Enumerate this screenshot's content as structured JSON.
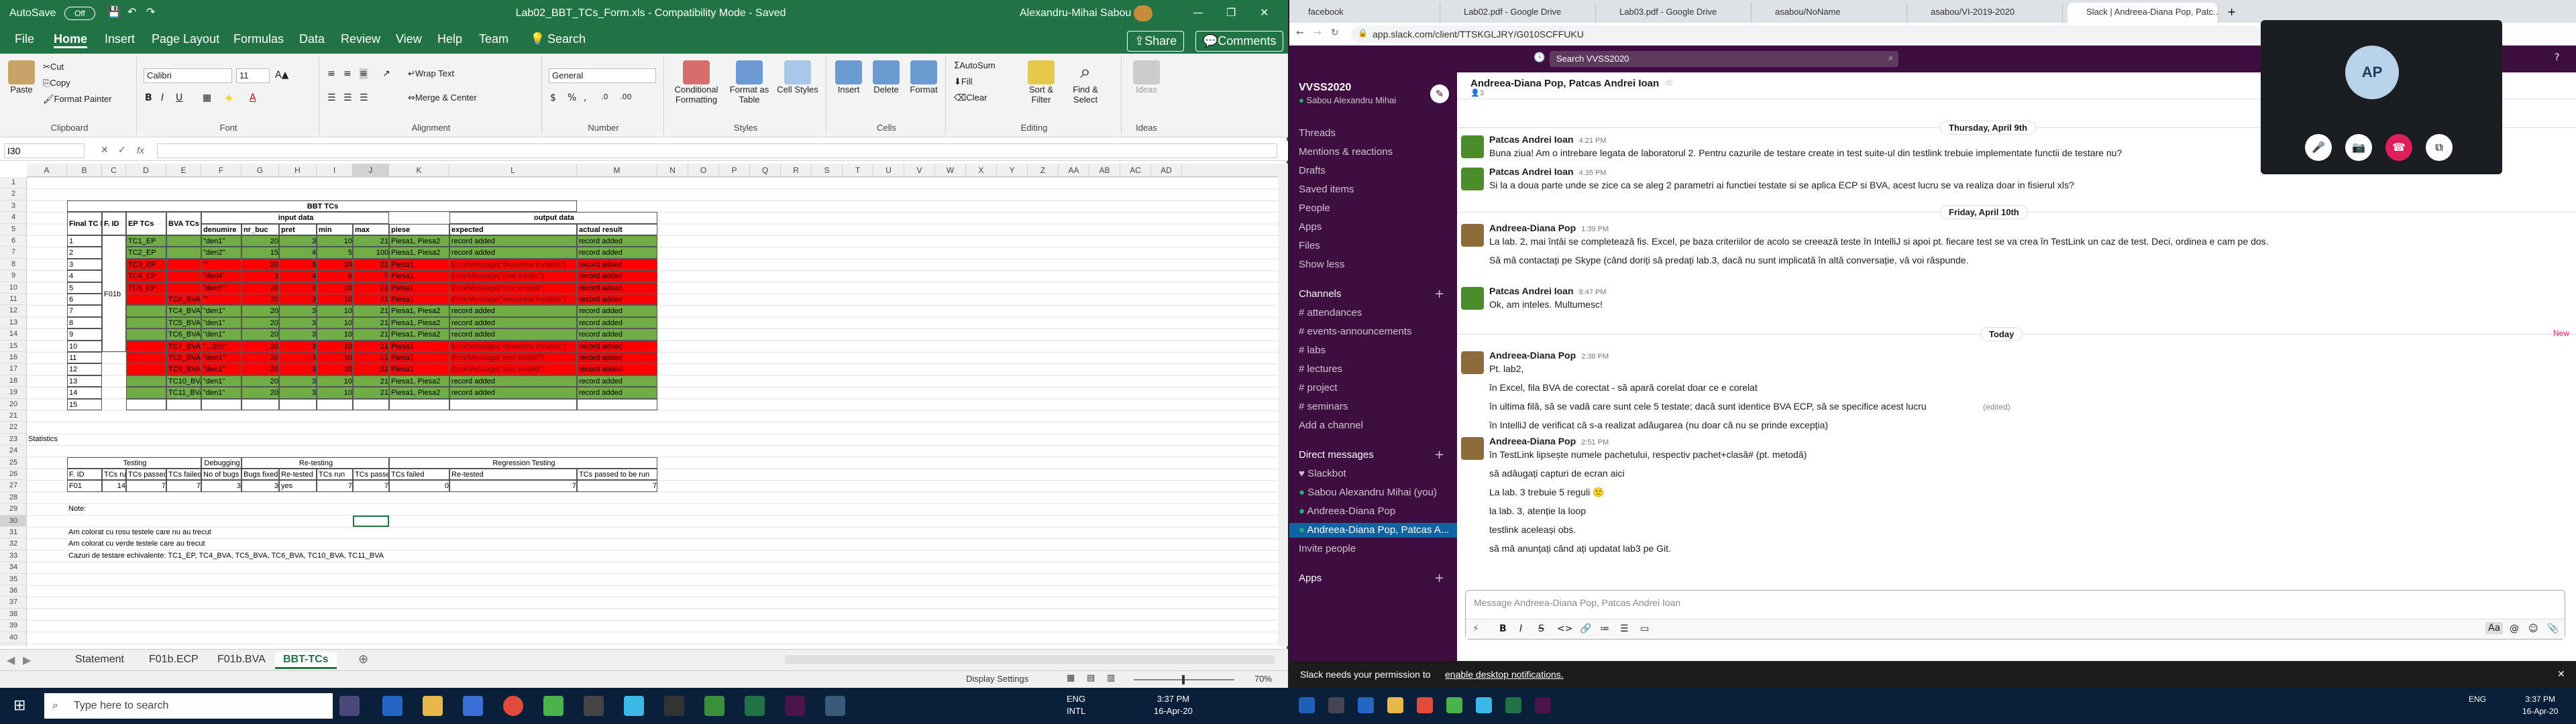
{
  "excel": {
    "autosave": "AutoSave",
    "autosave_state": "Off",
    "title": "Lab02_BBT_TCs_Form.xls - Compatibility Mode - Saved",
    "user": "Alexandru-Mihai Sabou",
    "tabs": [
      "File",
      "Home",
      "Insert",
      "Page Layout",
      "Formulas",
      "Data",
      "Review",
      "View",
      "Help",
      "Team"
    ],
    "tell_me": "Search",
    "share": "Share",
    "comments": "Comments",
    "ribbon": {
      "paste": "Paste",
      "cut": "Cut",
      "copy": "Copy",
      "format_painter": "Format Painter",
      "clipboard": "Clipboard",
      "font_name": "Calibri",
      "font_size": "11",
      "font": "Font",
      "wrap_text": "Wrap Text",
      "merge_center": "Merge & Center",
      "alignment": "Alignment",
      "number_format": "General",
      "number": "Number",
      "cond_format": "Conditional Formatting",
      "format_table": "Format as Table",
      "cell_styles": "Cell Styles",
      "styles": "Styles",
      "insert": "Insert",
      "delete": "Delete",
      "format": "Format",
      "cells": "Cells",
      "autosum": "AutoSum",
      "fill": "Fill",
      "clear": "Clear",
      "sort_filter": "Sort & Filter",
      "find_select": "Find & Select",
      "editing": "Editing",
      "ideas": "Ideas",
      "ideas_group": "Ideas"
    },
    "name_box": "I30",
    "formula": "",
    "columns": [
      "A",
      "B",
      "C",
      "D",
      "E",
      "F",
      "G",
      "H",
      "I",
      "J",
      "K",
      "L",
      "M",
      "N",
      "O",
      "P",
      "Q",
      "R",
      "S",
      "T",
      "U",
      "V",
      "W",
      "X",
      "Y",
      "Z",
      "AA",
      "AB",
      "AC",
      "AD"
    ],
    "sheets": [
      "Statement",
      "F01b.ECP",
      "F01b.BVA",
      "BBT-TCs"
    ],
    "active_sheet": "BBT-TCs",
    "status": {
      "display_settings": "Display Settings",
      "zoom": "70%"
    },
    "table": {
      "title": "BBT TCs",
      "input_data": "input data",
      "output_data": "output data",
      "h_final": "Final TC No.",
      "h_fid": "F. ID",
      "h_ep": "EP TCs",
      "h_bva": "BVA TCs",
      "h_cols": [
        "denumire",
        "nr_buc",
        "pret",
        "min",
        "max",
        "piese",
        "expected",
        "actual result"
      ],
      "fid": "F01b",
      "rows": [
        {
          "n": "1",
          "ep": "TC1_EP",
          "bva": "",
          "d": "\"den1\"",
          "nb": "20",
          "p": "3",
          "mn": "10",
          "mx": "21",
          "pi": "Piesa1, Piesa2",
          "ex": "record added",
          "ac": "record added",
          "c": "g"
        },
        {
          "n": "2",
          "ep": "TC2_EP",
          "bva": "",
          "d": "\"den2\"",
          "nb": "15",
          "p": "4",
          "mn": "5",
          "mx": "100",
          "pi": "Piesa1, Piesa2",
          "ex": "record added",
          "ac": "record added",
          "c": "g"
        },
        {
          "n": "3",
          "ep": "TC3_EP",
          "bva": "",
          "d": "\"\"",
          "nb": "20",
          "p": "3",
          "mn": "10",
          "mx": "21",
          "pi": "Piesa1",
          "ex": "ErrorMessage(\"denumire invalida\")",
          "ac": "record added",
          "c": "r"
        },
        {
          "n": "4",
          "ep": "TC4_EP",
          "bva": "",
          "d": "\"den4\"",
          "nb": "3",
          "p": "4",
          "mn": "6",
          "mx": "5",
          "pi": "Piesa1",
          "ex": "ErrorMessage(\"pret invalid\")",
          "ac": "record added",
          "c": "r"
        },
        {
          "n": "5",
          "ep": "TC5_EP",
          "bva": "",
          "d": "\"den5\"",
          "nb": "20",
          "p": "3",
          "mn": "10",
          "mx": "21",
          "pi": "Piesa1",
          "ex": "ErrorMessage(\"stoc invalid\")",
          "ac": "record added",
          "c": "r"
        },
        {
          "n": "6",
          "ep": "",
          "bva": "TC6_BVA",
          "d": "\"\"",
          "nb": "20",
          "p": "3",
          "mn": "10",
          "mx": "21",
          "pi": "Piesa1",
          "ex": "ErrorMessage(\"denumire invalida\")",
          "ac": "record added",
          "c": "r"
        },
        {
          "n": "7",
          "ep": "",
          "bva": "TC4_BVA",
          "d": "\"den1\"",
          "nb": "20",
          "p": "3",
          "mn": "10",
          "mx": "21",
          "pi": "Piesa1, Piesa2",
          "ex": "record added",
          "ac": "record added",
          "c": "g"
        },
        {
          "n": "8",
          "ep": "",
          "bva": "TC5_BVA",
          "d": "\"den1\"",
          "nb": "20",
          "p": "3",
          "mn": "10",
          "mx": "21",
          "pi": "Piesa1, Piesa2",
          "ex": "record added",
          "ac": "record added",
          "c": "g"
        },
        {
          "n": "9",
          "ep": "",
          "bva": "TC6_BVA",
          "d": "\"den1\"",
          "nb": "20",
          "p": "3",
          "mn": "10",
          "mx": "21",
          "pi": "Piesa1, Piesa2",
          "ex": "record added",
          "ac": "record added",
          "c": "g"
        },
        {
          "n": "10",
          "ep": "",
          "bva": "TC7_BVA",
          "d": "\"...255\"",
          "nb": "20",
          "p": "3",
          "mn": "10",
          "mx": "21",
          "pi": "Piesa1",
          "ex": "ErrorMessage(\"denumire invalida\")",
          "ac": "record added",
          "c": "r"
        },
        {
          "n": "11",
          "ep": "",
          "bva": "TC8_BVA",
          "d": "\"den1\"",
          "nb": "20",
          "p": "3",
          "mn": "10",
          "mx": "21",
          "pi": "Piesa1",
          "ex": "ErrorMessage(\"pret invalid\")",
          "ac": "record added",
          "c": "r"
        },
        {
          "n": "12",
          "ep": "",
          "bva": "TC9_BVA",
          "d": "\"den1\"",
          "nb": "20",
          "p": "3",
          "mn": "10",
          "mx": "21",
          "pi": "Piesa1",
          "ex": "ErrorMessage(\"stoc invalid\")",
          "ac": "record added",
          "c": "r"
        },
        {
          "n": "13",
          "ep": "",
          "bva": "TC10_BVA",
          "d": "\"den1\"",
          "nb": "20",
          "p": "3",
          "mn": "10",
          "mx": "21",
          "pi": "Piesa1, Piesa2",
          "ex": "record added",
          "ac": "record added",
          "c": "g"
        },
        {
          "n": "14",
          "ep": "",
          "bva": "TC11_BVA",
          "d": "\"den1\"",
          "nb": "20",
          "p": "3",
          "mn": "10",
          "mx": "21",
          "pi": "Piesa1, Piesa2",
          "ex": "record added",
          "ac": "record added",
          "c": "g"
        },
        {
          "n": "15",
          "ep": "",
          "bva": "",
          "d": "",
          "nb": "",
          "p": "",
          "mn": "",
          "mx": "",
          "pi": "",
          "ex": "",
          "ac": "",
          "c": ""
        }
      ]
    },
    "stats": {
      "title": "Statistics",
      "testing": "Testing",
      "debugging": "Debugging",
      "retesting": "Re-testing",
      "regression": "Regression Testing",
      "headers": [
        "F. ID",
        "TCs run",
        "TCs passed",
        "TCs failed",
        "No of bugs",
        "Bugs fixed",
        "Re-tested",
        "TCs run",
        "TCs passed",
        "TCs failed",
        "Re-tested",
        "TCs passed to be run"
      ],
      "values": [
        "F01",
        "14",
        "7",
        "7",
        "3",
        "3",
        "yes",
        "7",
        "7",
        "0",
        "7",
        "7"
      ]
    },
    "notes": [
      "Note:",
      "Am colorat cu rosu testele care nu au trecut",
      "Am colorat cu verde testele care au trecut",
      "Cazuri de testare echivalente: TC1_EP, TC4_BVA, TC5_BVA, TC6_BVA, TC10_BVA, TC11_BVA"
    ]
  },
  "browser": {
    "tabs": [
      "facebook",
      "Lab02.pdf - Google Drive",
      "Lab03.pdf - Google Drive",
      "asabou/NoName",
      "asabou/VI-2019-2020",
      "Slack | Andreea-Diana Pop, Patc..."
    ],
    "url": "app.slack.com/client/TTSKGLJRY/G010SCFFUKU"
  },
  "slack": {
    "search": "Search VVSS2020",
    "workspace": "VVSS2020",
    "user": "Sabou Alexandru Mihai",
    "nav": [
      "Threads",
      "Mentions & reactions",
      "Drafts",
      "Saved items",
      "People",
      "Apps",
      "Files",
      "Show less"
    ],
    "channels_label": "Channels",
    "channels": [
      "attendances",
      "events-announcements",
      "labs",
      "lectures",
      "project",
      "seminars"
    ],
    "add_channel": "Add a channel",
    "dm_label": "Direct messages",
    "dms": [
      "Slackbot",
      "Sabou Alexandru Mihai (you)",
      "Andreea-Diana Pop",
      "Andreea-Diana Pop, Patcas A..."
    ],
    "invite": "Invite people",
    "apps_label": "Apps",
    "chat_title": "Andreea-Diana Pop, Patcas Andrei Ioan",
    "member_count": "3",
    "new_label": "New",
    "days": [
      "Thursday, April 9th",
      "Friday, April 10th",
      "Today"
    ],
    "messages": [
      {
        "author": "Patcas Andrei Ioan",
        "time": "4:21 PM",
        "lines": [
          "Buna ziua! Am o intrebare legata de laboratorul 2. Pentru  cazurile de testare create in test suite-ul din testlink trebuie implementate functii de testare nu?"
        ]
      },
      {
        "author": "Patcas Andrei Ioan",
        "time": "4:35 PM",
        "lines": [
          "Si la a doua parte unde se zice ca se aleg 2 parametri ai functiei testate si se aplica ECP si BVA, acest lucru se va realiza doar in fisierul xls?"
        ]
      },
      {
        "author": "Andreea-Diana Pop",
        "time": "1:39 PM",
        "lines": [
          "La lab. 2, mai întâi se completează fis. Excel, pe baza criteriilor de acolo se creează teste în IntelliJ si apoi pt. fiecare test se va crea în TestLink un caz de test. Deci, ordinea e cam pe dos.",
          "Să mă contactați pe Skype (când doriți să predați lab.3, dacă nu sunt implicată în altă conversație, vă voi răspunde."
        ]
      },
      {
        "author": "Patcas Andrei Ioan",
        "time": "8:47 PM",
        "lines": [
          "Ok, am inteles. Multumesc!"
        ]
      },
      {
        "author": "Andreea-Diana Pop",
        "time": "2:38 PM",
        "lines": [
          "Pt. lab2,",
          "în Excel, fila BVA de corectat - să apară corelat doar ce e corelat",
          "în ultima filă, să se vadă care sunt cele 5 testate; dacă sunt identice BVA ECP, să se specifice acest lucru",
          "în IntelliJ de verificat că s-a realizat adăugarea (nu doar că nu se prinde excepția)"
        ]
      },
      {
        "author": "Andreea-Diana Pop",
        "time": "2:51 PM",
        "lines": [
          "în TestLink lipsește numele pachetului, respectiv pachet+clasă# (pt. metodă)",
          "să adăugați capturi de ecran aici",
          "La lab. 3 trebuie 5 reguli 🙁",
          "la lab. 3, atenție la loop",
          "testlink aceleași obs.",
          "să mă anunțați când ați updatat lab3 pe Git."
        ]
      }
    ],
    "edited": "(edited)",
    "composer_placeholder": "Message Andreea-Diana Pop, Patcas Andrei Ioan",
    "notice": "Slack needs your permission to",
    "notice_link": "enable desktop notifications.",
    "call_initials": "AP"
  },
  "taskbar": {
    "search": "Type here to search",
    "lang": "ENG",
    "region": "INTL",
    "time": "3:37 PM",
    "date": "16-Apr-20",
    "lang2": "ENG",
    "time2": "3:37 PM",
    "date2": "16-Apr-20"
  }
}
